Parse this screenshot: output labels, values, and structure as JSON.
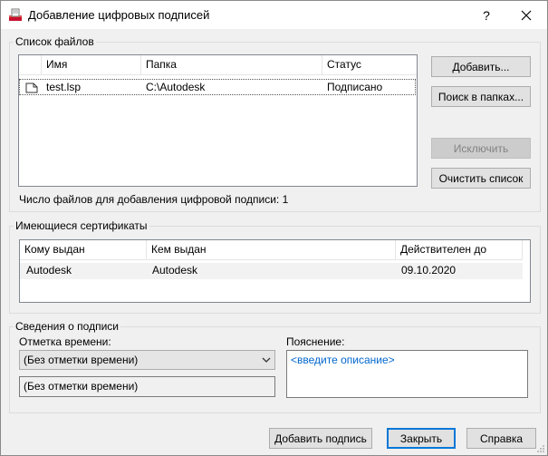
{
  "window": {
    "title": "Добавление цифровых подписей",
    "help": "?",
    "close": "✕"
  },
  "files": {
    "group_title": "Список файлов",
    "columns": [
      "Имя",
      "Папка",
      "Статус"
    ],
    "rows": [
      {
        "name": "test.lsp",
        "folder": "C:\\Autodesk",
        "status": "Подписано"
      }
    ],
    "buttons": {
      "add": "Добавить...",
      "search": "Поиск в папках...",
      "exclude": "Исключить",
      "clear": "Очистить список"
    },
    "count_text": "Число файлов для добавления цифровой подписи: 1"
  },
  "certs": {
    "group_title": "Имеющиеся сертификаты",
    "columns": [
      "Кому выдан",
      "Кем выдан",
      "Действителен до"
    ],
    "rows": [
      {
        "issued_to": "Autodesk",
        "issued_by": "Autodesk",
        "valid_until": "09.10.2020"
      }
    ]
  },
  "signature": {
    "group_title": "Сведения о подписи",
    "timestamp_label": "Отметка времени:",
    "timestamp_selected": "(Без отметки времени)",
    "timestamp_value": "(Без отметки времени)",
    "comment_label": "Пояснение:",
    "comment_placeholder": "<введите описание>"
  },
  "footer": {
    "add_signature": "Добавить подпись",
    "close": "Закрыть",
    "help": "Справка"
  },
  "colors": {
    "window_bg": "#f0f0f0",
    "selection_bg": "#f2f2f2",
    "accent": "#0078d7",
    "link_text": "#0066cc"
  }
}
